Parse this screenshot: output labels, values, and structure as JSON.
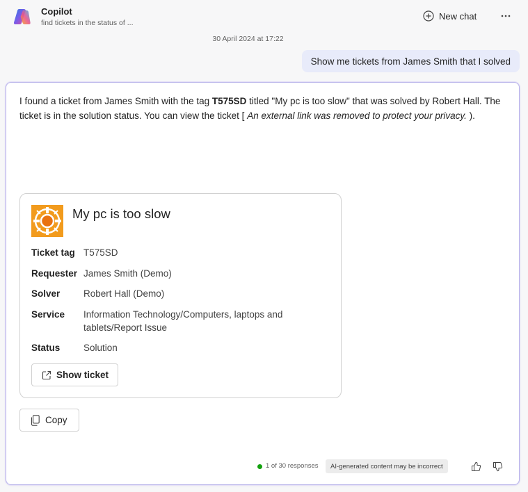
{
  "header": {
    "app_title": "Copilot",
    "subtitle": "find tickets in the status of ...",
    "new_chat_label": "New chat",
    "more_icon": "more-horizontal-icon"
  },
  "timestamp": "30 April 2024 at 17:22",
  "user_message": "Show me tickets from James Smith that I solved",
  "response": {
    "text_part1": "I found a ticket from James Smith with the tag ",
    "text_tag": "T575SD",
    "text_part2": " titled \"My pc is too slow\" that was solved by Robert Hall. The ticket is in the solution status. You can view the ticket [ ",
    "text_removed": "An external link was removed to protect your privacy.",
    "text_part3": " ).",
    "card": {
      "title": "My pc is too slow",
      "fields": [
        {
          "label": "Ticket tag",
          "value": "T575SD"
        },
        {
          "label": "Requester",
          "value": "James Smith (Demo)"
        },
        {
          "label": "Solver",
          "value": "Robert Hall (Demo)"
        },
        {
          "label": "Service",
          "value": "Information Technology/Computers, laptops and tablets/Report Issue"
        },
        {
          "label": "Status",
          "value": "Solution"
        }
      ],
      "show_ticket_label": "Show ticket"
    },
    "copy_label": "Copy",
    "response_count": "1 of 30 responses",
    "ai_disclaimer": "AI-generated content may be incorrect"
  },
  "colors": {
    "accent_border": "#b9b4ea",
    "user_bubble": "#e8ebfa",
    "card_icon_orange": "#f29b1d",
    "status_dot": "#13a10e"
  }
}
